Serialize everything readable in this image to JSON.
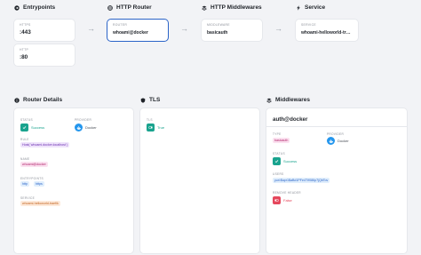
{
  "flow": {
    "entrypoints": {
      "title": "Entrypoints",
      "cards": [
        {
          "label": "HTTPS",
          "value": ":443"
        },
        {
          "label": "HTTP",
          "value": ":80"
        }
      ]
    },
    "router": {
      "title": "HTTP Router",
      "label": "ROUTER",
      "value": "whoami@docker"
    },
    "middlewares": {
      "title": "HTTP Middlewares",
      "label": "MIDDLEWARE",
      "value": "basicauth"
    },
    "service": {
      "title": "Service",
      "label": "SERVICE",
      "value": "whoami-helloworld-trac..."
    }
  },
  "router_details": {
    "title": "Router Details",
    "status_label": "STATUS",
    "status_value": "Success",
    "provider_label": "PROVIDER",
    "provider_value": "Docker",
    "rule_label": "RULE",
    "rule_value": "Host(`whoami.docker.localhost`)",
    "name_label": "NAME",
    "name_value": "whoami@docker",
    "entrypoints_label": "ENTRYPOINTS",
    "entrypoints": [
      "http",
      "https"
    ],
    "service_label": "SERVICE",
    "service_value": "whoami-helloworld-traefik"
  },
  "tls": {
    "title": "TLS",
    "tls_label": "TLS",
    "tls_value": "True"
  },
  "middlewares_panel": {
    "title": "Middlewares",
    "name": "auth@docker",
    "type_label": "TYPE",
    "type_value": "basicauth",
    "provider_label": "PROVIDER",
    "provider_value": "Docker",
    "status_label": "STATUS",
    "status_value": "Success",
    "users_label": "USERS",
    "users_value": "yuri:$apr1$aBd1PFe4T/f086p7jQbTov",
    "remove_header_label": "REMOVE HEADER",
    "remove_header_value": "False"
  },
  "colors": {
    "success": "#19a38e",
    "danger": "#e5485d",
    "docker": "#2496ed",
    "accent": "#2a63c8"
  }
}
